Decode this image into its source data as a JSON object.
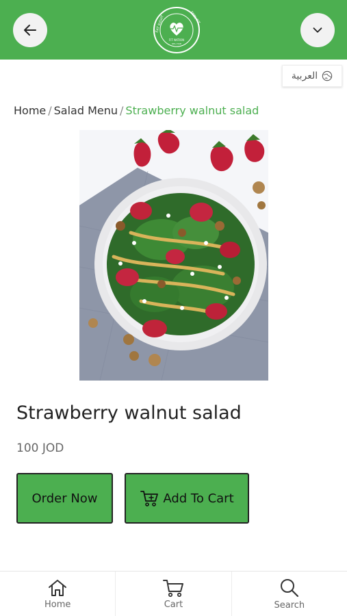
{
  "header": {
    "back_icon": "arrow-left-icon",
    "menu_icon": "chevron-down-icon",
    "logo": {
      "ring_text_left": "EAT RIGHT",
      "ring_text_right": "FEEL FIT",
      "brand": "FIT NATION",
      "tagline": "DELI HUB"
    },
    "accent_color": "#4caf50"
  },
  "language": {
    "label": "العربية",
    "icon": "globe-icon"
  },
  "breadcrumb": {
    "home": "Home",
    "separator": "/",
    "category": "Salad Menu",
    "current": "Strawberry walnut salad"
  },
  "product": {
    "image_alt": "strawberry walnut salad plate",
    "title": "Strawberry walnut salad",
    "price": "100 JOD"
  },
  "actions": {
    "order_label": "Order Now",
    "cart_label": "Add To Cart",
    "cart_icon": "cart-plus-icon"
  },
  "bottom_nav": [
    {
      "label": "Home",
      "icon": "home-icon"
    },
    {
      "label": "Cart",
      "icon": "cart-icon"
    },
    {
      "label": "Search",
      "icon": "search-icon"
    }
  ]
}
